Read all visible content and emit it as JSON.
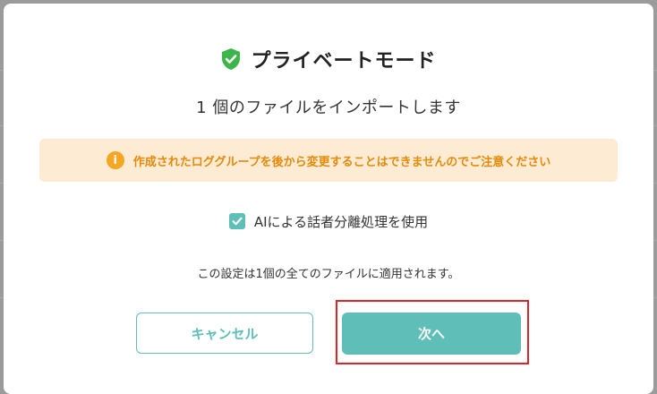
{
  "modal": {
    "title": "プライベートモード",
    "subtitle": "1 個のファイルをインポートします",
    "warning": "作成されたロググループを後から変更することはできませんのでご注意ください",
    "checkbox": {
      "label": "AIによる話者分離処理を使用",
      "checked": true
    },
    "note": "この設定は1個の全てのファイルに適用されます。",
    "buttons": {
      "cancel": "キャンセル",
      "next": "次へ"
    }
  },
  "colors": {
    "accent": "#5fbfb8",
    "shield": "#3cb54a",
    "warning_bg": "#fdebd3",
    "warning_text": "#e58a0a",
    "highlight": "#d9262b"
  },
  "icons": {
    "title": "shield-check-icon",
    "warning": "info-icon",
    "checkbox": "check-icon"
  }
}
